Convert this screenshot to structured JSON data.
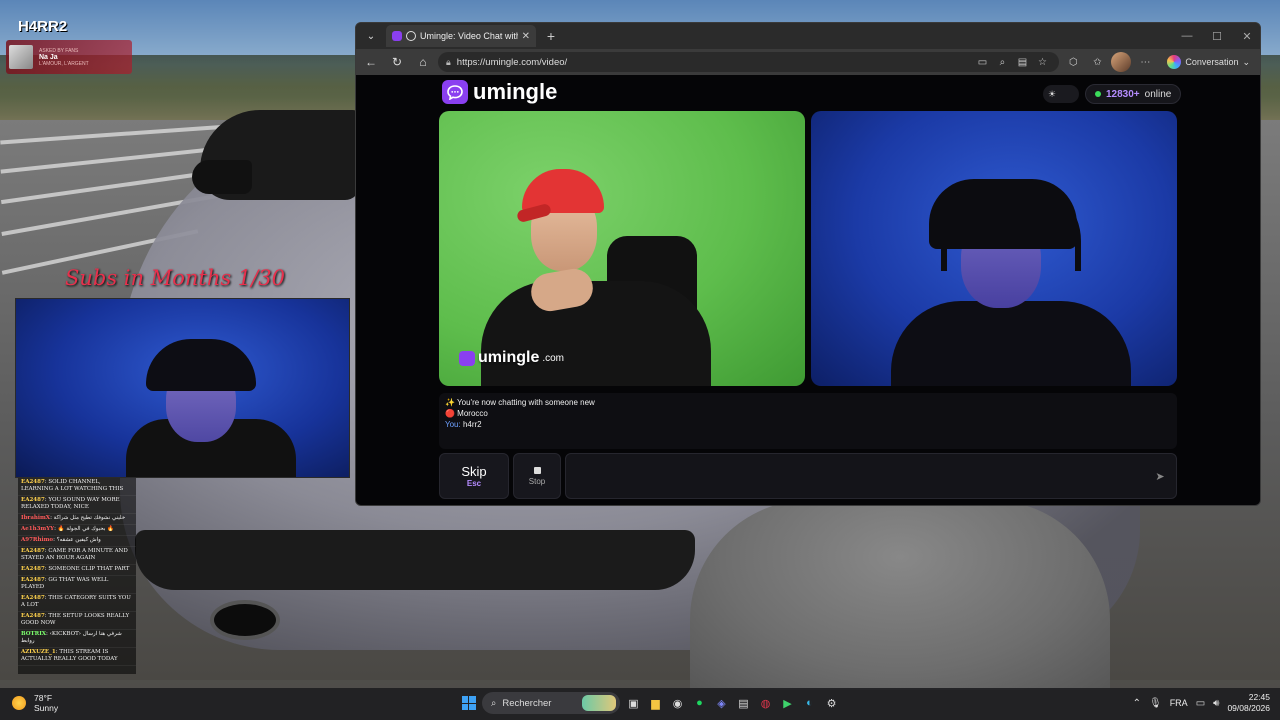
{
  "overlay": {
    "channel_logo": "H4RR2",
    "now_playing": {
      "small_line": "ASKED BY FANS",
      "title": "Na Ja",
      "subtitle": "L'AMOUR, L'ARGENT"
    },
    "subs_goal": "Subs in Months  1/30"
  },
  "stream_chat": {
    "messages": [
      {
        "user": "EA2487",
        "text": "SOLID CHANNEL, LEARNING A LOT WATCHING THIS",
        "color": "#ffd24d"
      },
      {
        "user": "EA2487",
        "text": "YOU SOUND WAY MORE RELAXED TODAY, NICE",
        "color": "#ffd24d"
      },
      {
        "user": "IbrahimX",
        "text": "خليني نشوفك تطيح مثل شراكة",
        "color": "#ff5a5a"
      },
      {
        "user": "Ae1h3mYY",
        "text": "🔥 بحبوك في الجولة 🔥",
        "color": "#ff5a5a"
      },
      {
        "user": "A97Rhimo",
        "text": "واش كيفين عشقه؟",
        "color": "#ff5a5a"
      },
      {
        "user": "EA2487",
        "text": "CAME FOR A MINUTE AND STAYED AN HOUR AGAIN",
        "color": "#ffd24d"
      },
      {
        "user": "EA2487",
        "text": "SOMEONE CLIP THAT PART",
        "color": "#ffd24d"
      },
      {
        "user": "EA2487",
        "text": "GG THAT WAS WELL PLAYED",
        "color": "#ffd24d"
      },
      {
        "user": "EA2487",
        "text": "THIS CATEGORY SUITS YOU A LOT",
        "color": "#ffd24d"
      },
      {
        "user": "EA2487",
        "text": "THE SETUP LOOKS REALLY GOOD NOW",
        "color": "#ffd24d"
      },
      {
        "user": "BOTRIX",
        "text": "‹KICKBOT› شرفي هنا ارسال روابط",
        "color": "#7dff6d"
      },
      {
        "user": "AZIXUZE_1",
        "text": "THIS STREAM IS ACTUALLY REALLY GOOD TODAY",
        "color": "#ffd24d"
      }
    ]
  },
  "browser": {
    "tab_title": "Umingle: Video Chat with Str...",
    "url": "https://umingle.com/video/",
    "conversation_label": "Conversation",
    "win_minimize": "—",
    "win_maximize": "☐",
    "win_close": "✕"
  },
  "umingle": {
    "brand": "umingle",
    "theme_icon": "☀",
    "online_count": "12830+",
    "online_label": "online",
    "watermark_brand": "umingle",
    "watermark_tld": ".com",
    "chat_log": {
      "line1": "✨ You're now chatting with someone new",
      "line2": "🔴 Morocco",
      "you_label": "You:",
      "you_text": " h4rr2"
    },
    "skip_label": "Skip",
    "skip_hint": "Esc",
    "stop_label": "Stop",
    "message_value": "",
    "send_icon": "➤"
  },
  "taskbar": {
    "weather_temp": "78°F",
    "weather_desc": "Sunny",
    "search_label": "Rechercher",
    "language": "FRA",
    "time": "22:45",
    "date": "09/08/2026"
  },
  "colors": {
    "accent": "#8a3ff0",
    "online": "#3bdc5b",
    "count": "#b58cff"
  }
}
